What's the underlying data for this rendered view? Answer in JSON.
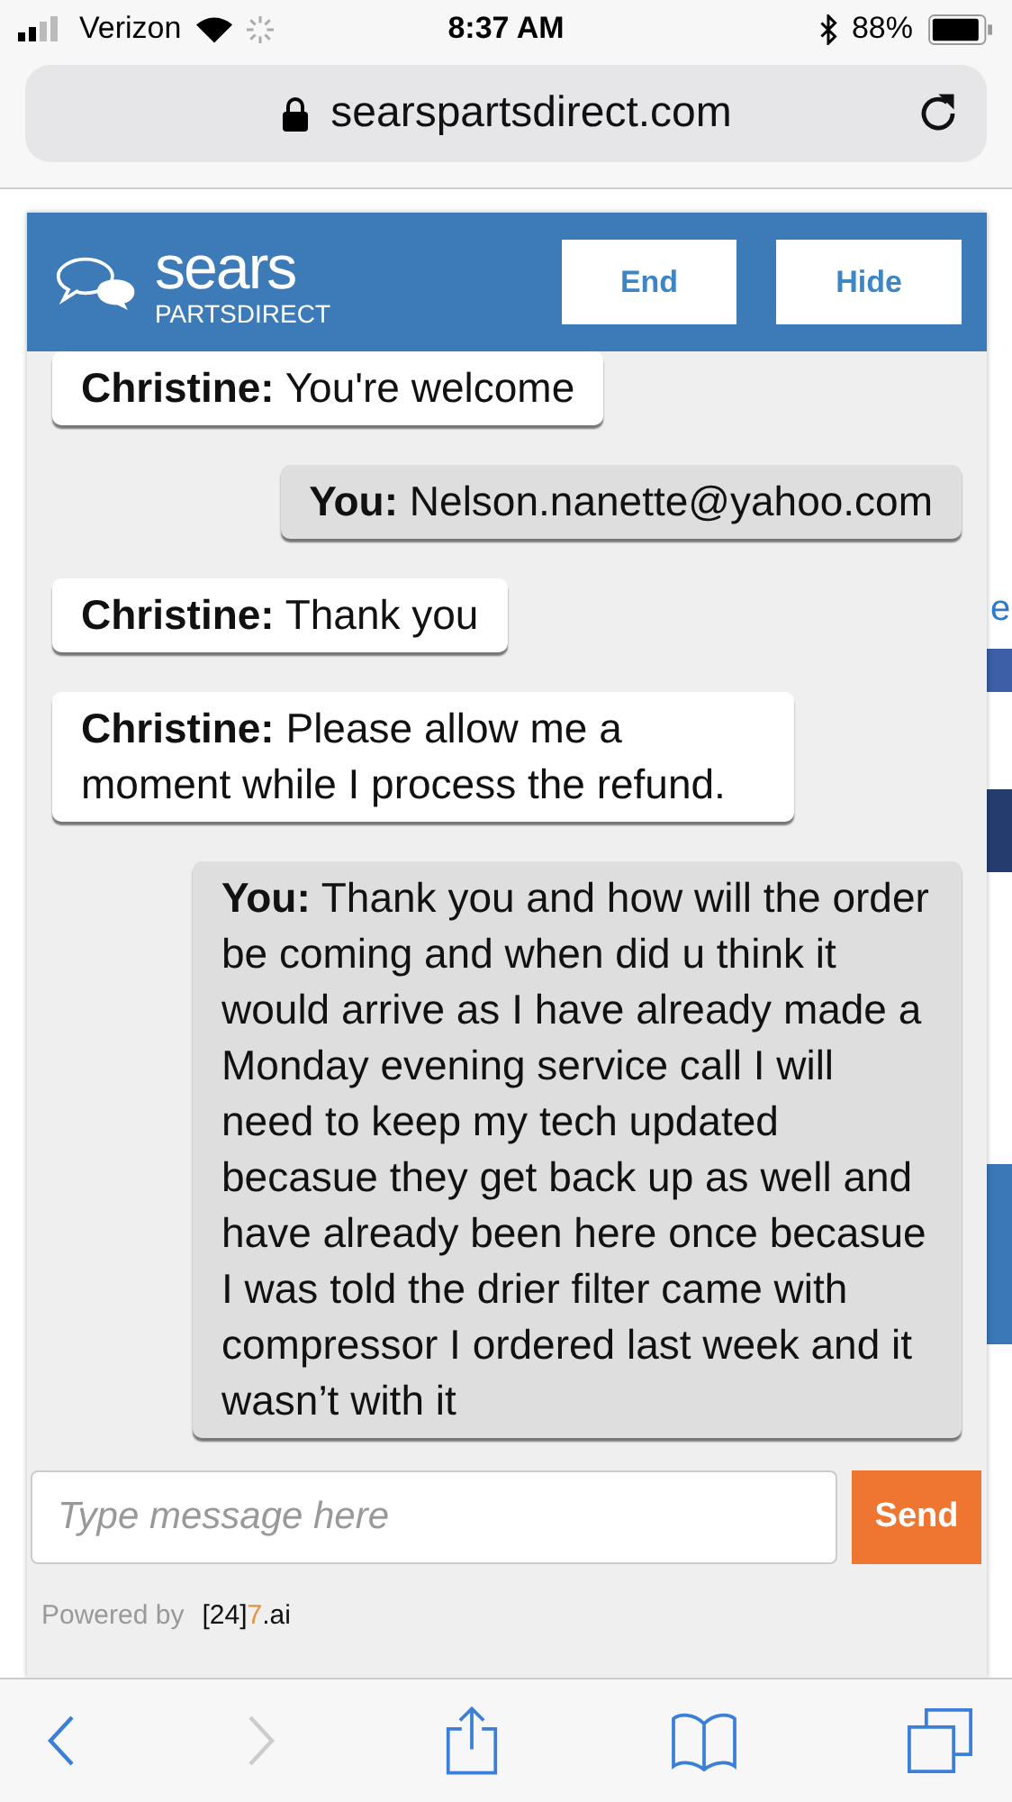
{
  "status_bar": {
    "carrier": "Verizon",
    "time": "8:37 AM",
    "battery": "88%"
  },
  "url_bar": {
    "url": "searspartsdirect.com"
  },
  "background_page": {
    "fragments": [
      {
        "text": "e",
        "kind": "link"
      },
      {
        "kind": "bar"
      },
      {
        "kind": "button"
      },
      {
        "kind": "block"
      }
    ]
  },
  "chat": {
    "brand": "sears",
    "brand_sub": "PARTSDIRECT",
    "buttons": [
      "End",
      "Hide"
    ],
    "messages": [
      {
        "kind": "agent",
        "text": "**Christine:** You're welcome"
      },
      {
        "kind": "user",
        "text": "**You:** Nelson.nanette@yahoo.com"
      },
      {
        "kind": "agent",
        "text": "**Christine:** Thank you"
      },
      {
        "kind": "agent",
        "text": "**Christine:** Please allow me a moment while I process the refund."
      },
      {
        "kind": "user",
        "text": "**You:** Thank you and how will the order be coming and when did u think it would arrive as I have already made a Monday evening service call I will need to keep my tech updated becasue they get back up as well and have already been here once becasue I was told the drier filter came with compressor I ordered last week and it wasn’t with it"
      }
    ],
    "input": {
      "placeholder": "Type message here"
    },
    "send": "Send",
    "powered_by": "Powered by",
    "provider": [
      {
        "text": "[24]",
        "accent": false
      },
      {
        "text": "7",
        "accent": true
      },
      {
        "text": ".ai",
        "accent": false
      }
    ]
  }
}
